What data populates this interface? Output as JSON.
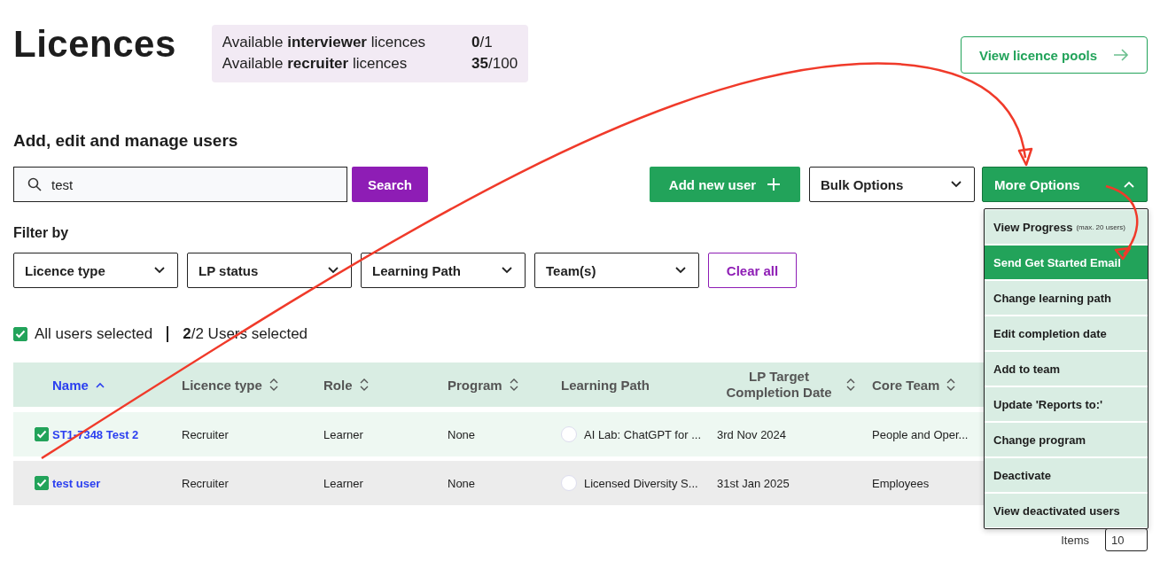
{
  "title": "Licences",
  "licence_summary": [
    {
      "text": "Available **interviewer** licences",
      "count": "**0**/1"
    },
    {
      "text": "Available **recruiter** licences",
      "count": "**35**/100"
    }
  ],
  "view_pools_button": "View licence pools",
  "section_title": "Add, edit and manage users",
  "search": {
    "value": "test",
    "button": "Search"
  },
  "add_user_button": "Add new user",
  "bulk_options": "Bulk Options",
  "more_options": {
    "label": "More Options",
    "expanded": true,
    "items": [
      {
        "label": "View Progress",
        "note": "(max. 20 users)",
        "selected": false
      },
      {
        "label": "Send Get Started Email",
        "selected": true
      },
      {
        "label": "Change learning path",
        "selected": false
      },
      {
        "label": "Edit completion date",
        "selected": false
      },
      {
        "label": "Add to team",
        "selected": false
      },
      {
        "label": "Update 'Reports to:'",
        "selected": false
      },
      {
        "label": "Change program",
        "selected": false
      },
      {
        "label": "Deactivate",
        "selected": false
      },
      {
        "label": "View deactivated users",
        "selected": false
      }
    ]
  },
  "filter_label": "Filter by",
  "filters": [
    "Licence type",
    "LP status",
    "Learning Path",
    "Team(s)"
  ],
  "clear_all": "Clear all",
  "selection": {
    "checked": true,
    "label": "All users selected",
    "count": "**2**/2 Users selected"
  },
  "table": {
    "columns": [
      {
        "label": "Name",
        "sortable": true,
        "sorted": true
      },
      {
        "label": "Licence type",
        "sortable": true,
        "sorted": false
      },
      {
        "label": "Role",
        "sortable": true,
        "sorted": false
      },
      {
        "label": "Program",
        "sortable": true,
        "sorted": false
      },
      {
        "label": "Learning Path",
        "sortable": false,
        "sorted": false
      },
      {
        "label": "LP Target Completion Date",
        "sortable": true,
        "sorted": false
      },
      {
        "label": "Core Team",
        "sortable": true,
        "sorted": false
      }
    ],
    "rows": [
      {
        "selected": true,
        "name": "ST1-7348 Test 2",
        "licence_type": "Recruiter",
        "role": "Learner",
        "program": "None",
        "lp_completed": false,
        "learning_path": "AI Lab: ChatGPT for ...",
        "target_date": "3rd Nov 2024",
        "core_team": "People and Oper..."
      },
      {
        "selected": true,
        "name": "test user",
        "licence_type": "Recruiter",
        "role": "Learner",
        "program": "None",
        "lp_completed": false,
        "learning_path": "Licensed Diversity S...",
        "target_date": "31st Jan 2025",
        "core_team": "Employees"
      }
    ]
  },
  "pagination": {
    "label": "Items",
    "value": "10"
  },
  "annotations": [
    {
      "kind": "arrow"
    },
    {
      "kind": "arrow"
    }
  ]
}
